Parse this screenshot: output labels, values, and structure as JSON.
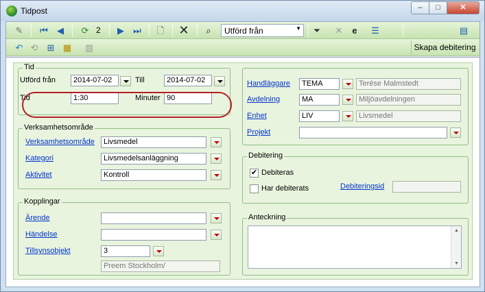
{
  "window": {
    "title": "Tidpost",
    "minimize": "–",
    "maximize": "□",
    "close": "✕"
  },
  "toolbar": {
    "page": "2",
    "combo_value": "Utförd från",
    "skapa_debitering": "Skapa debitering",
    "icons": [
      "pin-icon",
      "first-icon",
      "prev-icon",
      "refresh-icon",
      "next-icon",
      "last-icon",
      "new-icon",
      "delete-icon",
      "find-icon",
      "filter-icon",
      "clear-filter-icon",
      "e-icon",
      "list-icon",
      "export-icon",
      "back-icon",
      "reload-icon",
      "tree-icon",
      "report-icon",
      "document-icon"
    ]
  },
  "tid": {
    "legend": "Tid",
    "utford_fran_label": "Utförd från",
    "utford_fran": "2014-07-02",
    "till_label": "Till",
    "till": "2014-07-02",
    "tid_label": "Tid",
    "tid": "1:30",
    "minuter_label": "Minuter",
    "minuter": "90"
  },
  "verksamhet": {
    "legend": "Verksamhetsområde",
    "verksamhetsomrade_label": "Verksamhetsområde",
    "verksamhetsomrade": "Livsmedel",
    "kategori_label": "Kategori",
    "kategori": "Livsmedelsanläggning",
    "aktivitet_label": "Aktivitet",
    "aktivitet": "Kontroll"
  },
  "kopplingar": {
    "legend": "Kopplingar",
    "arende_label": "Ärende",
    "arende": "",
    "handelse_label": "Händelse",
    "handelse": "",
    "tillsynsobjekt_label": "Tillsynsobjekt",
    "tillsynsobjekt": "3",
    "tillsynsobjekt_name": "Preem Stockholm/"
  },
  "handlaggning": {
    "handlaggare_label": "Handläggare",
    "handlaggare": "TEMA",
    "handlaggare_name": "Terése Malmstedt",
    "avdelning_label": "Avdelning",
    "avdelning": "MA",
    "avdelning_name": "Miljöavdelningen",
    "enhet_label": "Enhet",
    "enhet": "LIV",
    "enhet_name": "Livsmedel",
    "projekt_label": "Projekt",
    "projekt": ""
  },
  "debitering": {
    "legend": "Debitering",
    "debiteras_label": "Debiteras",
    "debiteras_checked": true,
    "har_debiterats_label": "Har debiterats",
    "har_debiterats_checked": false,
    "debiteringsid_label": "Debiteringsid",
    "debiteringsid": ""
  },
  "anteckning": {
    "legend": "Anteckning",
    "text": ""
  },
  "colors": {
    "accent_red": "#c00000",
    "highlight_oval": "#b51f24",
    "link": "#0033cc",
    "panel_green": "#e9f4df"
  }
}
